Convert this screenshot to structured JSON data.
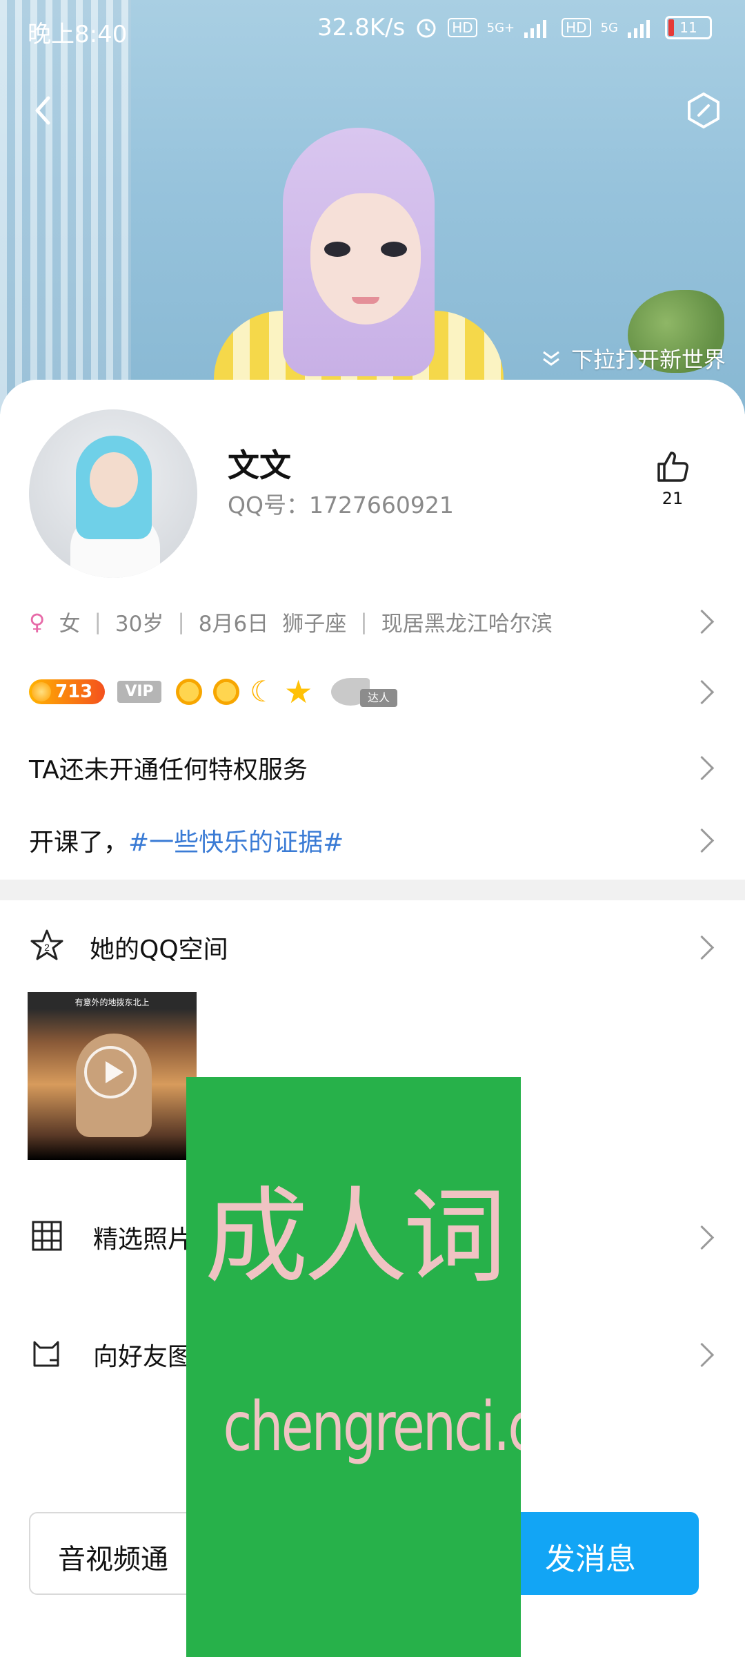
{
  "status_bar": {
    "time": "晚上8:40",
    "speed": "32.8K/s",
    "hd1": "HD",
    "net1": "5G+",
    "hd2": "HD",
    "net2": "5G",
    "battery": "11"
  },
  "header": {
    "pull_hint": "下拉打开新世界",
    "back_icon": "back-arrow-icon",
    "menu_icon": "hexagon-settings-icon"
  },
  "profile": {
    "nickname": "文文",
    "qq_number": "QQ号：1727660921",
    "like_count": "21",
    "gender": "女",
    "age": "30岁",
    "birthday": "8月6日",
    "zodiac": "狮子座",
    "location": "现居黑龙江哈尔滨"
  },
  "badges": {
    "coin_level": "713",
    "vip": "VIP",
    "expert": "达人"
  },
  "rows": {
    "privilege": "TA还未开通任何特权服务",
    "course_prefix": "开课了，",
    "course_hashtag": "#一些快乐的证据#",
    "qzone": "她的QQ空间",
    "photos": "精选照片",
    "share": "向好友图"
  },
  "video": {
    "caption": "有意外的地拨东北上"
  },
  "buttons": {
    "call": "音视频通",
    "message": "发消息"
  },
  "overlay": {
    "line1": "成人词",
    "line2": "chengrenci.com"
  },
  "colors": {
    "accent": "#12a5f5",
    "hashtag": "#3a7bd5",
    "overlay": "#27b14a"
  }
}
